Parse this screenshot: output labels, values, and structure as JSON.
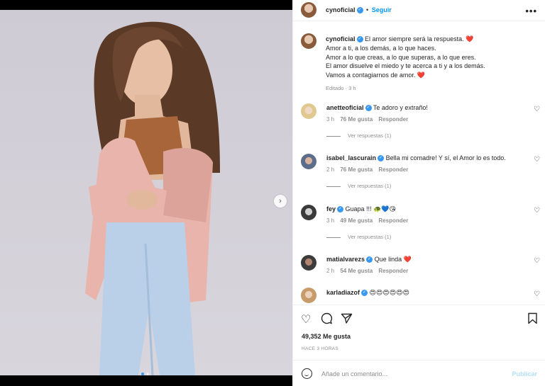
{
  "post": {
    "username": "cynoficial",
    "follow_label": "Seguir",
    "menu_glyph": "•••",
    "caption_lines": [
      "El amor siempre será la respuesta. ❤️",
      "Amor a ti, a los demás, a lo que haces.",
      "Amor a lo que creas, a lo que superas, a lo que eres.",
      "El amor disuelve el miedo y te acerca a ti y a los demás.",
      "Vamos a contagiarnos de amor. ❤️"
    ],
    "caption_meta": "Editado · 3 h",
    "carousel_next": "›"
  },
  "comments": [
    {
      "username": "anetteoficial",
      "text": "Te adoro y extraño!",
      "time": "3 h",
      "likes": "76 Me gusta",
      "reply": "Responder",
      "replies": "Ver respuestas (1)"
    },
    {
      "username": "isabel_lascurain",
      "text": "Bella mi comadre! Y sí, el Amor lo es todo.",
      "time": "2 h",
      "likes": "76 Me gusta",
      "reply": "Responder",
      "replies": "Ver respuestas (1)"
    },
    {
      "username": "fey",
      "text": "Guapa !!! 🐢💙😘",
      "time": "3 h",
      "likes": "49 Me gusta",
      "reply": "Responder",
      "replies": "Ver respuestas (1)"
    },
    {
      "username": "matialvarezs",
      "text": "Que linda ❤️",
      "time": "2 h",
      "likes": "54 Me gusta",
      "reply": "Responder",
      "replies": ""
    },
    {
      "username": "karladiazof",
      "text": "😍😍😍😍😍😍",
      "time": "",
      "likes": "",
      "reply": "",
      "replies": ""
    }
  ],
  "stats": {
    "likes": "49,352 Me gusta",
    "ago": "HACE 3 HORAS"
  },
  "composer": {
    "placeholder": "Añade un comentario...",
    "publish_label": "Publicar"
  },
  "icons": {
    "heart": "heart-icon",
    "comment": "comment-icon",
    "share": "share-icon",
    "save": "bookmark-icon"
  }
}
